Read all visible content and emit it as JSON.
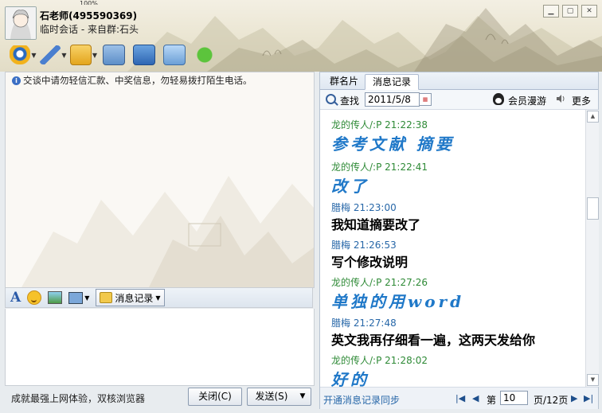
{
  "window": {
    "contact_name": "石老师(495590369)",
    "session_info": "临时会话 - 来自群:石头",
    "top_strip_text": "100%"
  },
  "left": {
    "notice": "交谈中请勿轻信汇款、中奖信息，勿轻易拨打陌生电话。",
    "toolbar_font_icon": "A",
    "message_record_label": "消息记录",
    "promo_text": "成就最强上网体验，双核浏览器",
    "close_label": "关闭(C)",
    "send_label": "发送(S)",
    "send_arrow": "▼"
  },
  "right": {
    "tabs": [
      "群名片",
      "消息记录"
    ],
    "search_label": "查找",
    "date_value": "2011/5/8",
    "vip_label": "会员漫游",
    "more_label": "更多",
    "messages": [
      {
        "sender": "龙的传人/:P",
        "time": "21:22:38",
        "text": "参考文献 摘要",
        "style": "art"
      },
      {
        "sender": "龙的传人/:P",
        "time": "21:22:41",
        "text": "改了",
        "style": "art"
      },
      {
        "sender": "腊梅",
        "time": "21:23:00",
        "text": "我知道摘要改了",
        "style": "plain"
      },
      {
        "sender": "腊梅",
        "time": "21:26:53",
        "text": "写个修改说明",
        "style": "plain"
      },
      {
        "sender": "龙的传人/:P",
        "time": "21:27:26",
        "text": "单独的用word",
        "style": "art"
      },
      {
        "sender": "腊梅",
        "time": "21:27:48",
        "text": "英文我再仔细看一遍，这两天发给你",
        "style": "plain"
      },
      {
        "sender": "龙的传人/:P",
        "time": "21:28:02",
        "text": "好的",
        "style": "art"
      }
    ],
    "sync_link": "开通消息记录同步",
    "page_prefix": "第",
    "page_value": "10",
    "page_total": "页/12页"
  },
  "colors": {
    "sender_friend": "#2e8a36",
    "sender_me": "#2767a8",
    "art_text": "#1f78c8"
  }
}
